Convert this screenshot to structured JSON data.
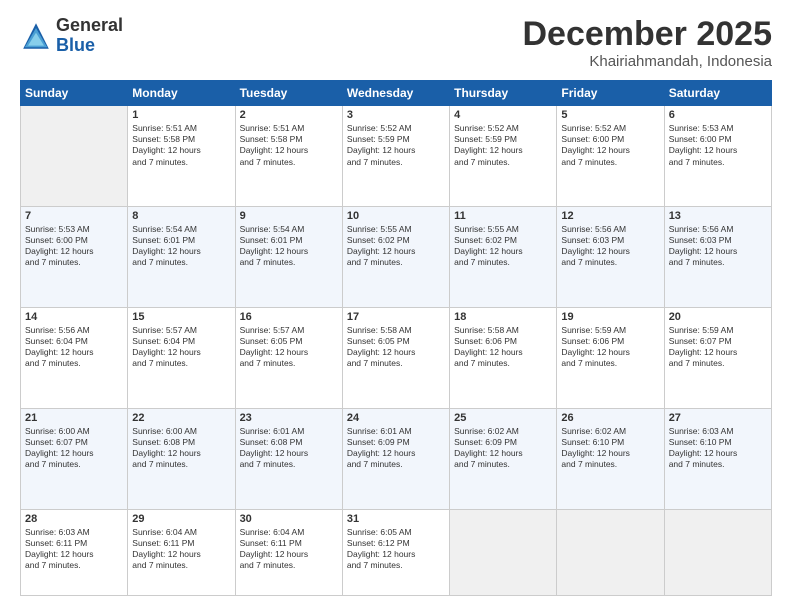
{
  "logo": {
    "general": "General",
    "blue": "Blue"
  },
  "title": "December 2025",
  "subtitle": "Khairiahmandah, Indonesia",
  "weekdays": [
    "Sunday",
    "Monday",
    "Tuesday",
    "Wednesday",
    "Thursday",
    "Friday",
    "Saturday"
  ],
  "weeks": [
    [
      {
        "day": "",
        "info": ""
      },
      {
        "day": "1",
        "info": "Sunrise: 5:51 AM\nSunset: 5:58 PM\nDaylight: 12 hours\nand 7 minutes."
      },
      {
        "day": "2",
        "info": "Sunrise: 5:51 AM\nSunset: 5:58 PM\nDaylight: 12 hours\nand 7 minutes."
      },
      {
        "day": "3",
        "info": "Sunrise: 5:52 AM\nSunset: 5:59 PM\nDaylight: 12 hours\nand 7 minutes."
      },
      {
        "day": "4",
        "info": "Sunrise: 5:52 AM\nSunset: 5:59 PM\nDaylight: 12 hours\nand 7 minutes."
      },
      {
        "day": "5",
        "info": "Sunrise: 5:52 AM\nSunset: 6:00 PM\nDaylight: 12 hours\nand 7 minutes."
      },
      {
        "day": "6",
        "info": "Sunrise: 5:53 AM\nSunset: 6:00 PM\nDaylight: 12 hours\nand 7 minutes."
      }
    ],
    [
      {
        "day": "7",
        "info": "Sunrise: 5:53 AM\nSunset: 6:00 PM\nDaylight: 12 hours\nand 7 minutes."
      },
      {
        "day": "8",
        "info": "Sunrise: 5:54 AM\nSunset: 6:01 PM\nDaylight: 12 hours\nand 7 minutes."
      },
      {
        "day": "9",
        "info": "Sunrise: 5:54 AM\nSunset: 6:01 PM\nDaylight: 12 hours\nand 7 minutes."
      },
      {
        "day": "10",
        "info": "Sunrise: 5:55 AM\nSunset: 6:02 PM\nDaylight: 12 hours\nand 7 minutes."
      },
      {
        "day": "11",
        "info": "Sunrise: 5:55 AM\nSunset: 6:02 PM\nDaylight: 12 hours\nand 7 minutes."
      },
      {
        "day": "12",
        "info": "Sunrise: 5:56 AM\nSunset: 6:03 PM\nDaylight: 12 hours\nand 7 minutes."
      },
      {
        "day": "13",
        "info": "Sunrise: 5:56 AM\nSunset: 6:03 PM\nDaylight: 12 hours\nand 7 minutes."
      }
    ],
    [
      {
        "day": "14",
        "info": "Sunrise: 5:56 AM\nSunset: 6:04 PM\nDaylight: 12 hours\nand 7 minutes."
      },
      {
        "day": "15",
        "info": "Sunrise: 5:57 AM\nSunset: 6:04 PM\nDaylight: 12 hours\nand 7 minutes."
      },
      {
        "day": "16",
        "info": "Sunrise: 5:57 AM\nSunset: 6:05 PM\nDaylight: 12 hours\nand 7 minutes."
      },
      {
        "day": "17",
        "info": "Sunrise: 5:58 AM\nSunset: 6:05 PM\nDaylight: 12 hours\nand 7 minutes."
      },
      {
        "day": "18",
        "info": "Sunrise: 5:58 AM\nSunset: 6:06 PM\nDaylight: 12 hours\nand 7 minutes."
      },
      {
        "day": "19",
        "info": "Sunrise: 5:59 AM\nSunset: 6:06 PM\nDaylight: 12 hours\nand 7 minutes."
      },
      {
        "day": "20",
        "info": "Sunrise: 5:59 AM\nSunset: 6:07 PM\nDaylight: 12 hours\nand 7 minutes."
      }
    ],
    [
      {
        "day": "21",
        "info": "Sunrise: 6:00 AM\nSunset: 6:07 PM\nDaylight: 12 hours\nand 7 minutes."
      },
      {
        "day": "22",
        "info": "Sunrise: 6:00 AM\nSunset: 6:08 PM\nDaylight: 12 hours\nand 7 minutes."
      },
      {
        "day": "23",
        "info": "Sunrise: 6:01 AM\nSunset: 6:08 PM\nDaylight: 12 hours\nand 7 minutes."
      },
      {
        "day": "24",
        "info": "Sunrise: 6:01 AM\nSunset: 6:09 PM\nDaylight: 12 hours\nand 7 minutes."
      },
      {
        "day": "25",
        "info": "Sunrise: 6:02 AM\nSunset: 6:09 PM\nDaylight: 12 hours\nand 7 minutes."
      },
      {
        "day": "26",
        "info": "Sunrise: 6:02 AM\nSunset: 6:10 PM\nDaylight: 12 hours\nand 7 minutes."
      },
      {
        "day": "27",
        "info": "Sunrise: 6:03 AM\nSunset: 6:10 PM\nDaylight: 12 hours\nand 7 minutes."
      }
    ],
    [
      {
        "day": "28",
        "info": "Sunrise: 6:03 AM\nSunset: 6:11 PM\nDaylight: 12 hours\nand 7 minutes."
      },
      {
        "day": "29",
        "info": "Sunrise: 6:04 AM\nSunset: 6:11 PM\nDaylight: 12 hours\nand 7 minutes."
      },
      {
        "day": "30",
        "info": "Sunrise: 6:04 AM\nSunset: 6:11 PM\nDaylight: 12 hours\nand 7 minutes."
      },
      {
        "day": "31",
        "info": "Sunrise: 6:05 AM\nSunset: 6:12 PM\nDaylight: 12 hours\nand 7 minutes."
      },
      {
        "day": "",
        "info": ""
      },
      {
        "day": "",
        "info": ""
      },
      {
        "day": "",
        "info": ""
      }
    ]
  ]
}
